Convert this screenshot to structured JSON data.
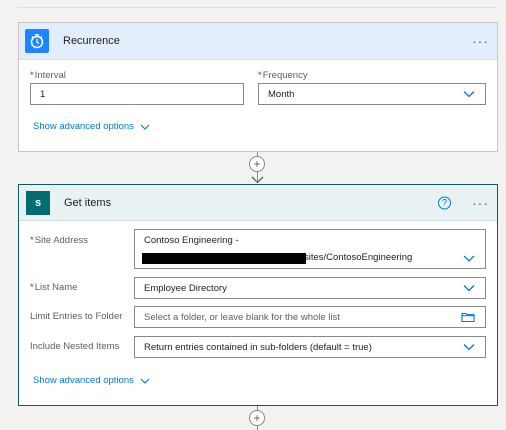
{
  "recurrence": {
    "title": "Recurrence",
    "more": "···",
    "interval": {
      "label": "Interval",
      "value": "1"
    },
    "frequency": {
      "label": "Frequency",
      "value": "Month"
    },
    "advanced": "Show advanced options"
  },
  "connector": {
    "plus": "+"
  },
  "get_items": {
    "title": "Get items",
    "icon_letter": "s",
    "help": "?",
    "more": "···",
    "site_address": {
      "label": "Site Address",
      "line1": "Contoso Engineering -",
      "line2_suffix": "sites/ContosoEngineering"
    },
    "list_name": {
      "label": "List Name",
      "value": "Employee Directory"
    },
    "limit_folder": {
      "label": "Limit Entries to Folder",
      "placeholder": "Select a folder, or leave blank for the whole list"
    },
    "nested": {
      "label": "Include Nested Items",
      "value": "Return entries contained in sub-folders (default = true)"
    },
    "advanced": "Show advanced options"
  },
  "colors": {
    "accent": "#0078d4",
    "recurrence_header": "#e3eefc",
    "sharepoint": "#036c70"
  },
  "icons": {
    "recurrence": "clock-icon",
    "sharepoint": "sharepoint-icon",
    "folder": "folder-icon",
    "chevron": "chevron-down-icon"
  }
}
